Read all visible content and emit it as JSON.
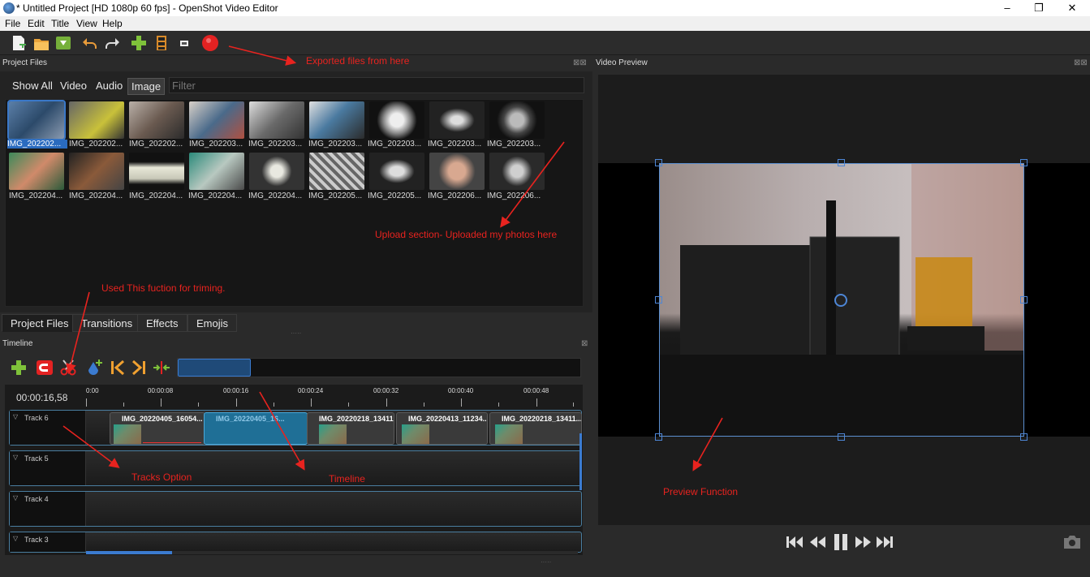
{
  "window": {
    "title": "* Untitled Project [HD 1080p 60 fps] - OpenShot Video Editor",
    "controls": [
      "–",
      "❐",
      "✕"
    ]
  },
  "menu": [
    "File",
    "Edit",
    "Title",
    "View",
    "Help"
  ],
  "docks": {
    "project_files": "Project Files",
    "video_preview": "Video Preview",
    "timeline": "Timeline"
  },
  "project_files": {
    "filter_tabs": [
      "Show All",
      "Video",
      "Audio",
      "Image"
    ],
    "active_filter": "Image",
    "filter_placeholder": "Filter",
    "row1": [
      "IMG_202202...",
      "IMG_202202...",
      "IMG_202202...",
      "IMG_202203...",
      "IMG_202203...",
      "IMG_202203...",
      "IMG_202203...",
      "IMG_202203...",
      "IMG_202203..."
    ],
    "row2": [
      "IMG_202204...",
      "IMG_202204...",
      "IMG_202204...",
      "IMG_202204...",
      "IMG_202204...",
      "IMG_202205...",
      "IMG_202205...",
      "IMG_202206...",
      "IMG_202206..."
    ]
  },
  "bottom_tabs": [
    "Project Files",
    "Transitions",
    "Effects",
    "Emojis"
  ],
  "timeline": {
    "timecode": "00:00:16,58",
    "ruler": [
      "0:00",
      "00:00:08",
      "00:00:16",
      "00:00:24",
      "00:00:32",
      "00:00:40",
      "00:00:48"
    ],
    "tracks": [
      "Track 6",
      "Track 5",
      "Track 4",
      "Track 3"
    ],
    "clips": [
      "IMG_20220405_16054...",
      "IMG_20220405_16...",
      "IMG_20220218_13411...",
      "IMG_20220413_11234...",
      "IMG_20220218_13411..."
    ]
  },
  "annotations": {
    "export": "Exported files from here",
    "upload": "Upload section- Uploaded my photos here",
    "trim": "Used This fuction for triming.",
    "tracks": "Tracks Option",
    "timeline": "Timeline",
    "preview": "Preview Function"
  },
  "colors": {
    "accent_red": "#e8231f",
    "selection_blue": "#4d86d6",
    "panel_dark": "#1e1e1e"
  }
}
